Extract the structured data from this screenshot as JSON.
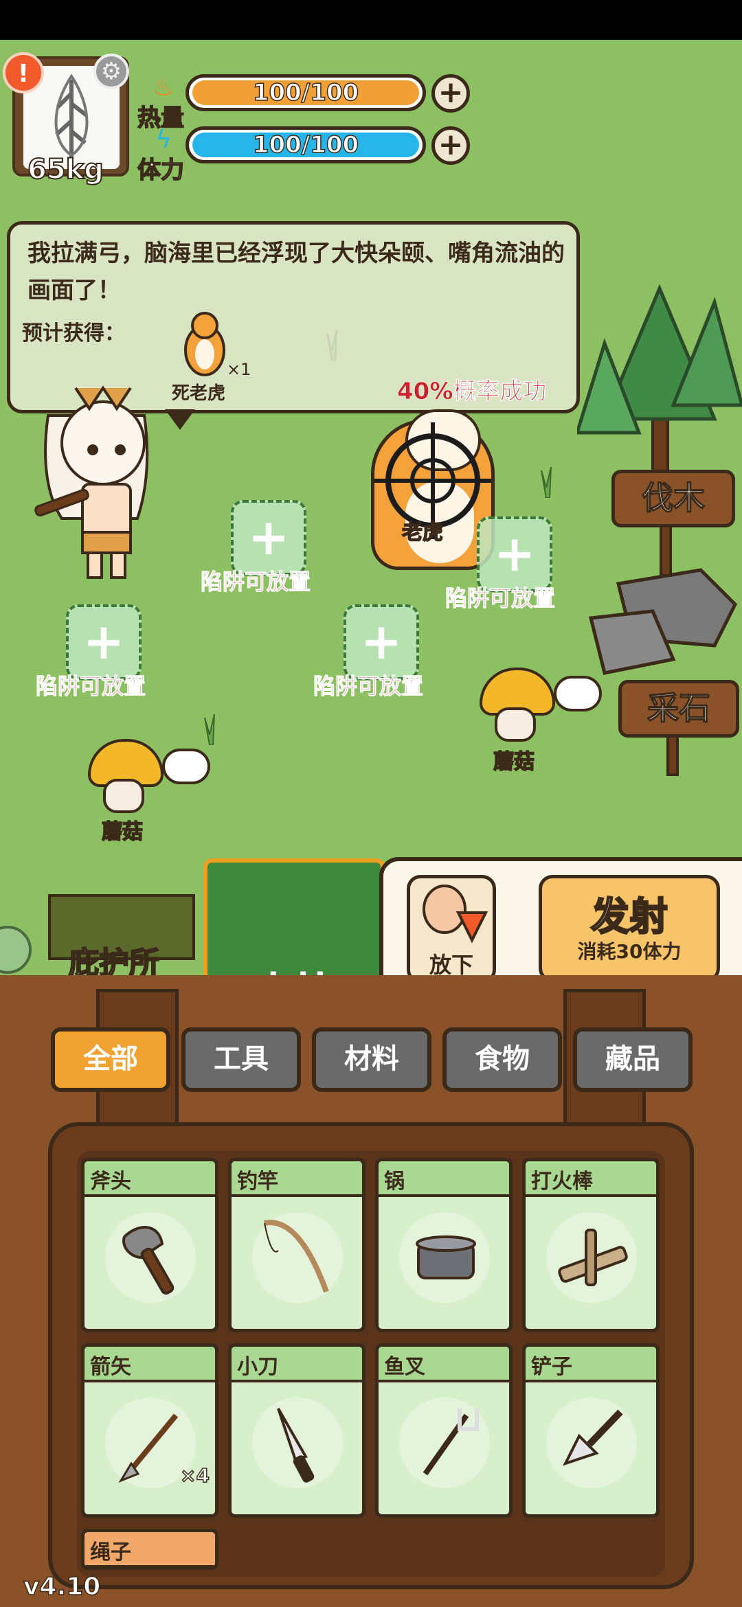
{
  "player": {
    "weight": "65kg",
    "stats": [
      {
        "label": "热量",
        "value": "100/100",
        "color": "#f0a035",
        "icon": "flame-icon",
        "fill": 1.0
      },
      {
        "label": "体力",
        "value": "100/100",
        "color": "#26b5e8",
        "icon": "lightning-icon",
        "fill": 1.0
      }
    ]
  },
  "dialog": {
    "text": "我拉满弓，脑海里已经浮现了大快朵颐、嘴角流油的画面了！",
    "expected_label": "预计获得：",
    "reward_name": "死老虎",
    "reward_qty": "×1",
    "probability": "40%概率成功"
  },
  "target": {
    "label": "老虎"
  },
  "signs": {
    "chop": "伐木",
    "quarry": "采石"
  },
  "traps": {
    "label": "陷阱可放置"
  },
  "mushrooms": {
    "label": "蘑菇"
  },
  "location": {
    "shelter": "庇护所",
    "forest": "森林"
  },
  "actions": {
    "drop": "放下",
    "fire": "发射",
    "fire_cost": "消耗30体力"
  },
  "tabs": [
    {
      "label": "全部",
      "active": true
    },
    {
      "label": "工具",
      "active": false
    },
    {
      "label": "材料",
      "active": false
    },
    {
      "label": "食物",
      "active": false
    },
    {
      "label": "藏品",
      "active": false
    }
  ],
  "inventory": [
    {
      "name": "斧头",
      "icon": "axe-icon"
    },
    {
      "name": "钓竿",
      "icon": "fishing-rod-icon"
    },
    {
      "name": "锅",
      "icon": "pot-icon"
    },
    {
      "name": "打火棒",
      "icon": "fire-drill-icon"
    },
    {
      "name": "箭矢",
      "icon": "arrow-icon",
      "qty": "×4"
    },
    {
      "name": "小刀",
      "icon": "knife-icon"
    },
    {
      "name": "鱼叉",
      "icon": "fish-spear-icon"
    },
    {
      "name": "铲子",
      "icon": "shovel-icon"
    },
    {
      "name": "绳子",
      "icon": "rope-icon"
    }
  ],
  "version": "v4.10"
}
